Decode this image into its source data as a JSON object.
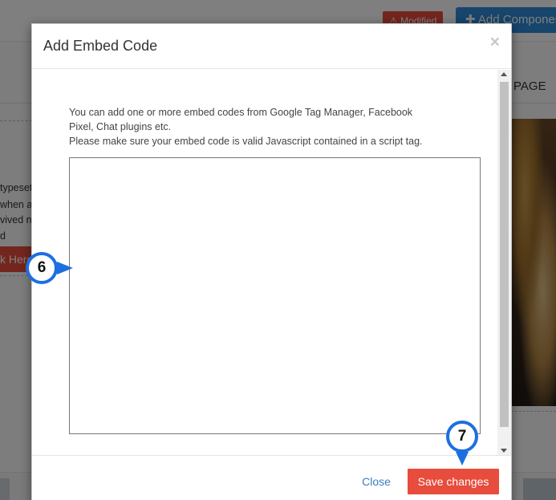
{
  "background": {
    "badge_modified": "⚠ Modified",
    "add_component": "✚ Add Component",
    "page_tab": "PAGE",
    "text_lines": [
      "typeset",
      "when a",
      "vived n",
      "d"
    ],
    "red_button": "k Here"
  },
  "modal": {
    "title": "Add Embed Code",
    "close_symbol": "×",
    "description": [
      "You can add one or more embed codes from Google Tag Manager, Facebook",
      "Pixel, Chat plugins etc.",
      "Please make sure your embed code is valid Javascript contained in a script tag."
    ],
    "textarea_value": "",
    "close_label": "Close",
    "save_label": "Save changes"
  },
  "markers": {
    "textarea_marker": "6",
    "save_marker": "7"
  },
  "colors": {
    "accent_red": "#e74c3c",
    "primary_blue": "#2e8ad8",
    "marker_blue": "#1d6fe0",
    "link_blue": "#3a7ec1"
  }
}
